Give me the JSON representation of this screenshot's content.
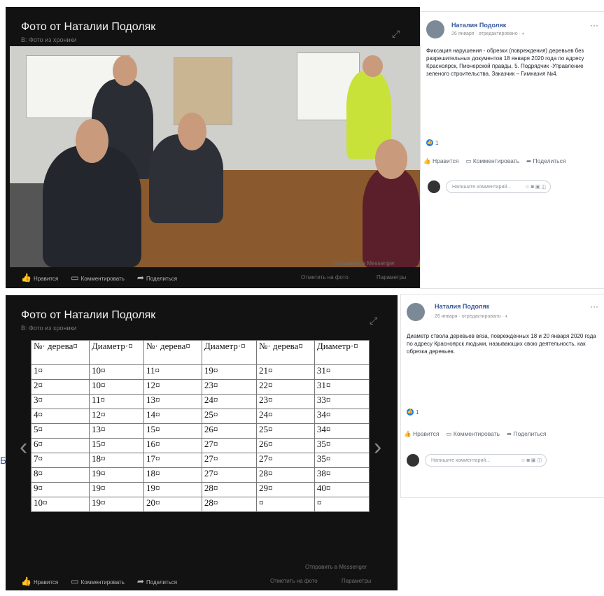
{
  "viewer1": {
    "title": "Фото от Наталии Подоляк",
    "subtitle": "В: Фото из хроники",
    "actions": {
      "like": "Нравится",
      "comment": "Комментировать",
      "share": "Поделиться"
    },
    "messenger": "Отправить в Messenger",
    "tag": "Отметить на фото",
    "params": "Параметры"
  },
  "card1": {
    "author": "Наталия Подоляк",
    "meta": "26 января · отредактировано · ",
    "text": "Фиксация нарушения - обрезки (повреждения) деревьев без разрешительных документов 18 января 2020 года по адресу Красноярск, Пионерской правды, 5. Подрядчик -Управление зеленого строительства. Заказчик – Гимназия №4.",
    "likes_count": "1",
    "actions": {
      "like": "Нравится",
      "comment": "Комментировать",
      "share": "Поделиться"
    },
    "comment_placeholder": "Напишите комментарий..."
  },
  "viewer2": {
    "title": "Фото от Наталии Подоляк",
    "subtitle": "В: Фото из хроники",
    "actions": {
      "like": "Нравится",
      "comment": "Комментировать",
      "share": "Поделиться"
    },
    "messenger": "Отправить в Messenger",
    "tag": "Отметить на фото",
    "params": "Параметры"
  },
  "card2": {
    "author": "Наталия Подоляк",
    "meta": "26 января · отредактировано · ",
    "text": "Диаметр ствола деревьев вяза, поврежденных 18 и 20 января 2020 года по адресу Красноярск людьми, называющих свою деятельность, как обрезка деревьев.",
    "likes_count": "1",
    "actions": {
      "like": "Нравится",
      "comment": "Комментировать",
      "share": "Поделиться"
    },
    "comment_placeholder": "Напишите комментарий..."
  },
  "tree_table": {
    "headers": [
      "№· дерева¤",
      "Диаметр·¤",
      "№· дерева¤",
      "Диаметр·¤",
      "№· дерева¤",
      "Диаметр·¤"
    ],
    "rows": [
      [
        "1¤",
        "10¤",
        "11¤",
        "19¤",
        "21¤",
        "31¤"
      ],
      [
        "2¤",
        "10¤",
        "12¤",
        "23¤",
        "22¤",
        "31¤"
      ],
      [
        "3¤",
        "11¤",
        "13¤",
        "24¤",
        "23¤",
        "33¤"
      ],
      [
        "4¤",
        "12¤",
        "14¤",
        "25¤",
        "24¤",
        "34¤"
      ],
      [
        "5¤",
        "13¤",
        "15¤",
        "26¤",
        "25¤",
        "34¤"
      ],
      [
        "6¤",
        "15¤",
        "16¤",
        "27¤",
        "26¤",
        "35¤"
      ],
      [
        "7¤",
        "18¤",
        "17¤",
        "27¤",
        "27¤",
        "35¤"
      ],
      [
        "8¤",
        "19¤",
        "18¤",
        "27¤",
        "28¤",
        "38¤"
      ],
      [
        "9¤",
        "19¤",
        "19¤",
        "28¤",
        "29¤",
        "40¤"
      ],
      [
        "10¤",
        "19¤",
        "20¤",
        "28¤",
        "¤",
        "¤"
      ]
    ]
  },
  "edge_letter": "Б",
  "icons": [
    "like-icon",
    "comment-icon",
    "share-icon",
    "expand-icon",
    "globe-icon",
    "more-icon",
    "emoji-icon",
    "camera-icon",
    "gif-icon",
    "sticker-icon",
    "chevron-left-icon",
    "chevron-right-icon"
  ]
}
